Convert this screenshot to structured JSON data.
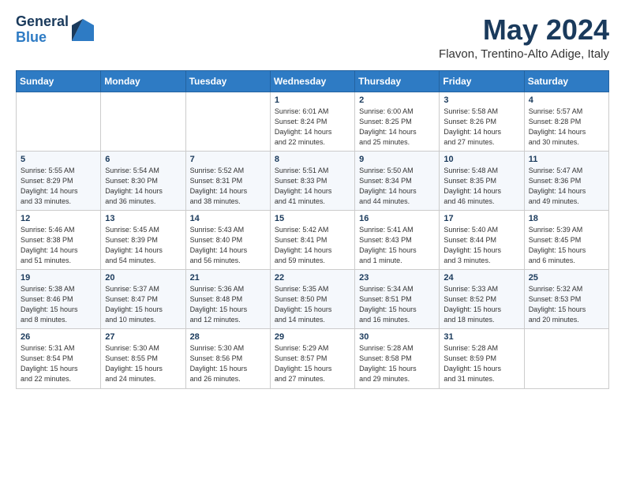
{
  "header": {
    "logo_general": "General",
    "logo_blue": "Blue",
    "month": "May 2024",
    "location": "Flavon, Trentino-Alto Adige, Italy"
  },
  "weekdays": [
    "Sunday",
    "Monday",
    "Tuesday",
    "Wednesday",
    "Thursday",
    "Friday",
    "Saturday"
  ],
  "weeks": [
    [
      {
        "day": "",
        "info": ""
      },
      {
        "day": "",
        "info": ""
      },
      {
        "day": "",
        "info": ""
      },
      {
        "day": "1",
        "info": "Sunrise: 6:01 AM\nSunset: 8:24 PM\nDaylight: 14 hours\nand 22 minutes."
      },
      {
        "day": "2",
        "info": "Sunrise: 6:00 AM\nSunset: 8:25 PM\nDaylight: 14 hours\nand 25 minutes."
      },
      {
        "day": "3",
        "info": "Sunrise: 5:58 AM\nSunset: 8:26 PM\nDaylight: 14 hours\nand 27 minutes."
      },
      {
        "day": "4",
        "info": "Sunrise: 5:57 AM\nSunset: 8:28 PM\nDaylight: 14 hours\nand 30 minutes."
      }
    ],
    [
      {
        "day": "5",
        "info": "Sunrise: 5:55 AM\nSunset: 8:29 PM\nDaylight: 14 hours\nand 33 minutes."
      },
      {
        "day": "6",
        "info": "Sunrise: 5:54 AM\nSunset: 8:30 PM\nDaylight: 14 hours\nand 36 minutes."
      },
      {
        "day": "7",
        "info": "Sunrise: 5:52 AM\nSunset: 8:31 PM\nDaylight: 14 hours\nand 38 minutes."
      },
      {
        "day": "8",
        "info": "Sunrise: 5:51 AM\nSunset: 8:33 PM\nDaylight: 14 hours\nand 41 minutes."
      },
      {
        "day": "9",
        "info": "Sunrise: 5:50 AM\nSunset: 8:34 PM\nDaylight: 14 hours\nand 44 minutes."
      },
      {
        "day": "10",
        "info": "Sunrise: 5:48 AM\nSunset: 8:35 PM\nDaylight: 14 hours\nand 46 minutes."
      },
      {
        "day": "11",
        "info": "Sunrise: 5:47 AM\nSunset: 8:36 PM\nDaylight: 14 hours\nand 49 minutes."
      }
    ],
    [
      {
        "day": "12",
        "info": "Sunrise: 5:46 AM\nSunset: 8:38 PM\nDaylight: 14 hours\nand 51 minutes."
      },
      {
        "day": "13",
        "info": "Sunrise: 5:45 AM\nSunset: 8:39 PM\nDaylight: 14 hours\nand 54 minutes."
      },
      {
        "day": "14",
        "info": "Sunrise: 5:43 AM\nSunset: 8:40 PM\nDaylight: 14 hours\nand 56 minutes."
      },
      {
        "day": "15",
        "info": "Sunrise: 5:42 AM\nSunset: 8:41 PM\nDaylight: 14 hours\nand 59 minutes."
      },
      {
        "day": "16",
        "info": "Sunrise: 5:41 AM\nSunset: 8:43 PM\nDaylight: 15 hours\nand 1 minute."
      },
      {
        "day": "17",
        "info": "Sunrise: 5:40 AM\nSunset: 8:44 PM\nDaylight: 15 hours\nand 3 minutes."
      },
      {
        "day": "18",
        "info": "Sunrise: 5:39 AM\nSunset: 8:45 PM\nDaylight: 15 hours\nand 6 minutes."
      }
    ],
    [
      {
        "day": "19",
        "info": "Sunrise: 5:38 AM\nSunset: 8:46 PM\nDaylight: 15 hours\nand 8 minutes."
      },
      {
        "day": "20",
        "info": "Sunrise: 5:37 AM\nSunset: 8:47 PM\nDaylight: 15 hours\nand 10 minutes."
      },
      {
        "day": "21",
        "info": "Sunrise: 5:36 AM\nSunset: 8:48 PM\nDaylight: 15 hours\nand 12 minutes."
      },
      {
        "day": "22",
        "info": "Sunrise: 5:35 AM\nSunset: 8:50 PM\nDaylight: 15 hours\nand 14 minutes."
      },
      {
        "day": "23",
        "info": "Sunrise: 5:34 AM\nSunset: 8:51 PM\nDaylight: 15 hours\nand 16 minutes."
      },
      {
        "day": "24",
        "info": "Sunrise: 5:33 AM\nSunset: 8:52 PM\nDaylight: 15 hours\nand 18 minutes."
      },
      {
        "day": "25",
        "info": "Sunrise: 5:32 AM\nSunset: 8:53 PM\nDaylight: 15 hours\nand 20 minutes."
      }
    ],
    [
      {
        "day": "26",
        "info": "Sunrise: 5:31 AM\nSunset: 8:54 PM\nDaylight: 15 hours\nand 22 minutes."
      },
      {
        "day": "27",
        "info": "Sunrise: 5:30 AM\nSunset: 8:55 PM\nDaylight: 15 hours\nand 24 minutes."
      },
      {
        "day": "28",
        "info": "Sunrise: 5:30 AM\nSunset: 8:56 PM\nDaylight: 15 hours\nand 26 minutes."
      },
      {
        "day": "29",
        "info": "Sunrise: 5:29 AM\nSunset: 8:57 PM\nDaylight: 15 hours\nand 27 minutes."
      },
      {
        "day": "30",
        "info": "Sunrise: 5:28 AM\nSunset: 8:58 PM\nDaylight: 15 hours\nand 29 minutes."
      },
      {
        "day": "31",
        "info": "Sunrise: 5:28 AM\nSunset: 8:59 PM\nDaylight: 15 hours\nand 31 minutes."
      },
      {
        "day": "",
        "info": ""
      }
    ]
  ]
}
